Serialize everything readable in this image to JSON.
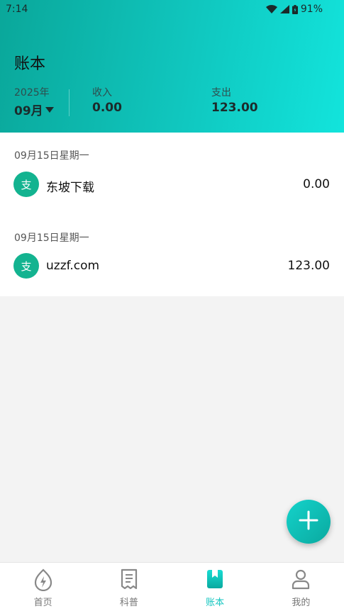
{
  "status": {
    "time": "7:14",
    "battery": "91%"
  },
  "header": {
    "title": "账本",
    "year": "2025年",
    "month": "09月",
    "income_label": "收入",
    "income_value": "0.00",
    "expense_label": "支出",
    "expense_value": "123.00"
  },
  "groups": [
    {
      "date": "09月15日星期一",
      "entries": [
        {
          "badge": "支",
          "name": "东坡下载",
          "amount": "0.00"
        }
      ]
    },
    {
      "date": "09月15日星期一",
      "entries": [
        {
          "badge": "支",
          "name": "uzzf.com",
          "amount": "123.00"
        }
      ]
    }
  ],
  "fab": {
    "icon": "plus-icon"
  },
  "tabs": [
    {
      "label": "首页",
      "icon": "home-flame-icon",
      "active": false
    },
    {
      "label": "科普",
      "icon": "document-icon",
      "active": false
    },
    {
      "label": "账本",
      "icon": "ledger-book-icon",
      "active": true
    },
    {
      "label": "我的",
      "icon": "user-icon",
      "active": false
    }
  ],
  "colors": {
    "accent": "#14c6c0",
    "badge": "#13b390",
    "header_start": "#0aa79a",
    "header_end": "#12e4dc"
  }
}
